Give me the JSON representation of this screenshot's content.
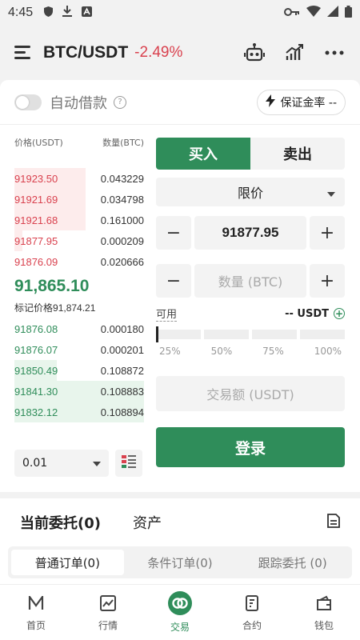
{
  "status_bar": {
    "time": "4:45"
  },
  "header": {
    "pair": "BTC/USDT",
    "change": "-2.49%"
  },
  "borrow": {
    "label": "自动借款",
    "help": "?",
    "margin_label": "保证金率 --"
  },
  "book": {
    "price_header": "价格(USDT)",
    "qty_header": "数量(BTC)",
    "asks": [
      {
        "price": "91923.50",
        "qty": "0.043229",
        "depth": 0.55
      },
      {
        "price": "91921.69",
        "qty": "0.034798",
        "depth": 0.55
      },
      {
        "price": "91921.68",
        "qty": "0.161000",
        "depth": 0.55
      },
      {
        "price": "91877.95",
        "qty": "0.000209",
        "depth": 0.06
      },
      {
        "price": "91876.09",
        "qty": "0.020666",
        "depth": 0.0
      }
    ],
    "last_price": "91,865.10",
    "mark_label": "标记价格",
    "mark_price": "91,874.21",
    "bids": [
      {
        "price": "91876.08",
        "qty": "0.000180",
        "depth": 0.0
      },
      {
        "price": "91876.07",
        "qty": "0.000201",
        "depth": 0.0
      },
      {
        "price": "91850.49",
        "qty": "0.108872",
        "depth": 0.33
      },
      {
        "price": "91841.30",
        "qty": "0.108883",
        "depth": 1.0
      },
      {
        "price": "91832.12",
        "qty": "0.108894",
        "depth": 1.0
      }
    ],
    "depth_step": "0.01"
  },
  "form": {
    "buy_label": "买入",
    "sell_label": "卖出",
    "order_type": "限价",
    "price_value": "91877.95",
    "qty_placeholder": "数量 (BTC)",
    "avail_label": "可用",
    "avail_value": "-- USDT",
    "pcts": [
      "25%",
      "50%",
      "75%",
      "100%"
    ],
    "slider_fraction": 0,
    "amount_placeholder": "交易额 (USDT)",
    "login_label": "登录"
  },
  "orders": {
    "tab_current": "当前委托(0)",
    "tab_assets": "资产",
    "types": [
      "普通订单(0)",
      "条件订单(0)",
      "跟踪委托 (0)"
    ]
  },
  "nav": {
    "items": [
      "首页",
      "行情",
      "交易",
      "合约",
      "钱包"
    ],
    "active": "交易"
  },
  "colors": {
    "green": "#2f8d5a",
    "red": "#d9414e"
  }
}
